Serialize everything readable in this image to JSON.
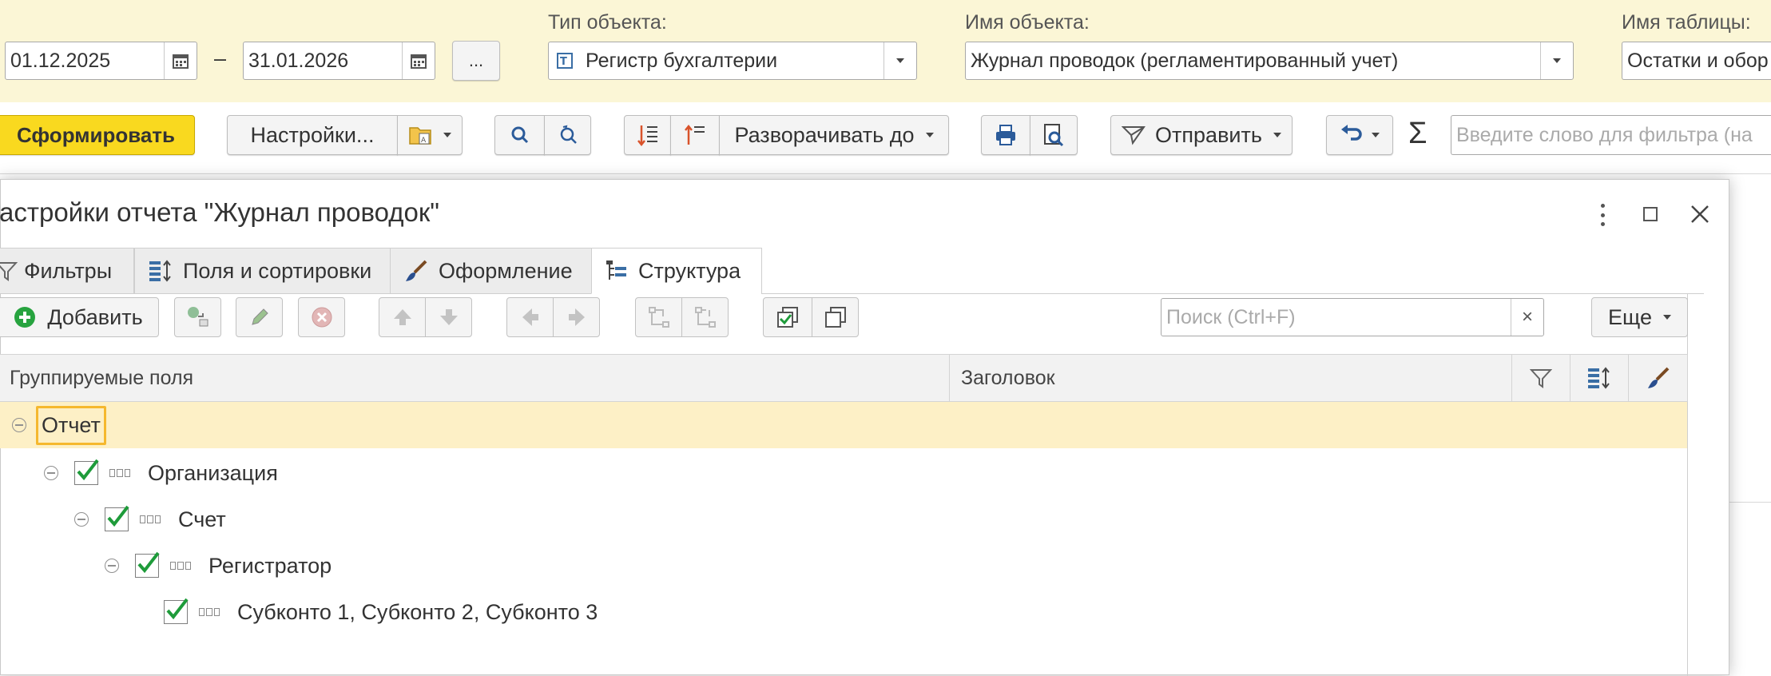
{
  "filters": {
    "date_from": "01.12.2025",
    "date_dash": "–",
    "date_to": "31.01.2026",
    "ellipsis": "...",
    "object_type_label": "Тип объекта:",
    "object_type_value": "Регистр бухгалтерии",
    "object_name_label": "Имя объекта:",
    "object_name_value": "Журнал проводок (регламентированный учет)",
    "table_name_label": "Имя таблицы:",
    "table_name_value": "Остатки и обор"
  },
  "toolbar": {
    "generate": "Сформировать",
    "settings": "Настройки...",
    "expand_to": "Разворачивать до",
    "send": "Отправить",
    "sigma": "Σ",
    "filter_placeholder": "Введите слово для фильтра (на"
  },
  "dialog": {
    "title": "астройки отчета \"Журнал проводок\"",
    "tabs": [
      "Фильтры",
      "Поля и сортировки",
      "Оформление",
      "Структура"
    ],
    "add_button": "Добавить",
    "search_placeholder": "Поиск (Ctrl+F)",
    "search_clear": "×",
    "more_button": "Еще",
    "columns": {
      "grouped_fields": "Группируемые поля",
      "heading": "Заголовок"
    },
    "tree": [
      {
        "label": "Отчет"
      },
      {
        "label": "Организация"
      },
      {
        "label": "Счет"
      },
      {
        "label": "Регистратор"
      },
      {
        "label": "Субконто 1, Субконто 2, Субконто 3"
      }
    ]
  },
  "colors": {
    "top_bg": "#fbf6d6",
    "accent_yellow": "#f9d91f",
    "selected_row": "#fdf0c6",
    "check_green": "#1e9b3a"
  }
}
